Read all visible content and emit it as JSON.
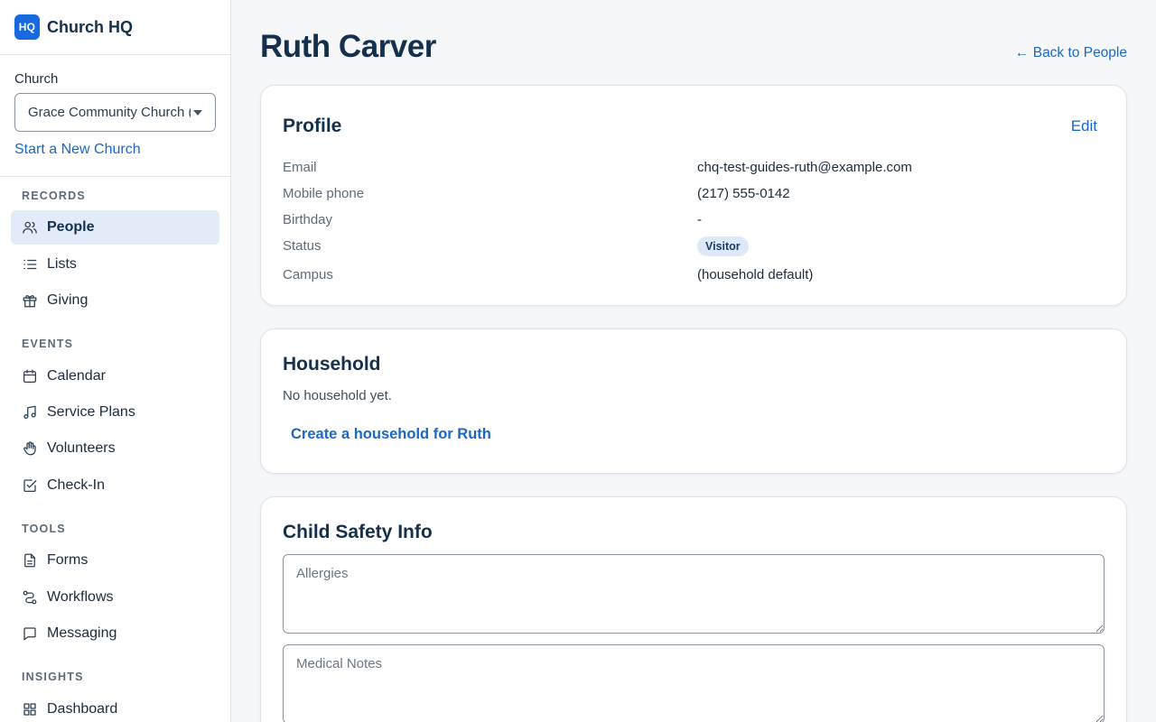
{
  "brand": {
    "logo": "HQ",
    "name": "Church HQ"
  },
  "church": {
    "label": "Church",
    "selected": "Grace Community Church (",
    "new_link": "Start a New Church"
  },
  "nav": {
    "records": {
      "title": "RECORDS",
      "people": "People",
      "lists": "Lists",
      "giving": "Giving"
    },
    "events": {
      "title": "EVENTS",
      "calendar": "Calendar",
      "service_plans": "Service Plans",
      "volunteers": "Volunteers",
      "check_in": "Check-In"
    },
    "tools": {
      "title": "TOOLS",
      "forms": "Forms",
      "workflows": "Workflows",
      "messaging": "Messaging"
    },
    "insights": {
      "title": "INSIGHTS",
      "dashboard": "Dashboard"
    },
    "active": "People"
  },
  "page": {
    "title": "Ruth Carver",
    "back_link": "← Back to People"
  },
  "profile": {
    "title": "Profile",
    "edit": "Edit",
    "fields": {
      "email_label": "Email",
      "email": "chq-test-guides-ruth@example.com",
      "phone_label": "Mobile phone",
      "phone": "(217) 555-0142",
      "birthday_label": "Birthday",
      "birthday": "-",
      "status_label": "Status",
      "status": "Visitor",
      "campus_label": "Campus",
      "campus": "(household default)"
    }
  },
  "household": {
    "title": "Household",
    "empty": "No household yet.",
    "create_link": "Create a household for Ruth"
  },
  "child_safety": {
    "title": "Child Safety Info",
    "allergies_placeholder": "Allergies",
    "medical_placeholder": "Medical Notes"
  },
  "colors": {
    "accent": "#1a68c5",
    "brand": "#1769e0",
    "heading": "#14304d",
    "active_bg": "#e2ecf9"
  }
}
